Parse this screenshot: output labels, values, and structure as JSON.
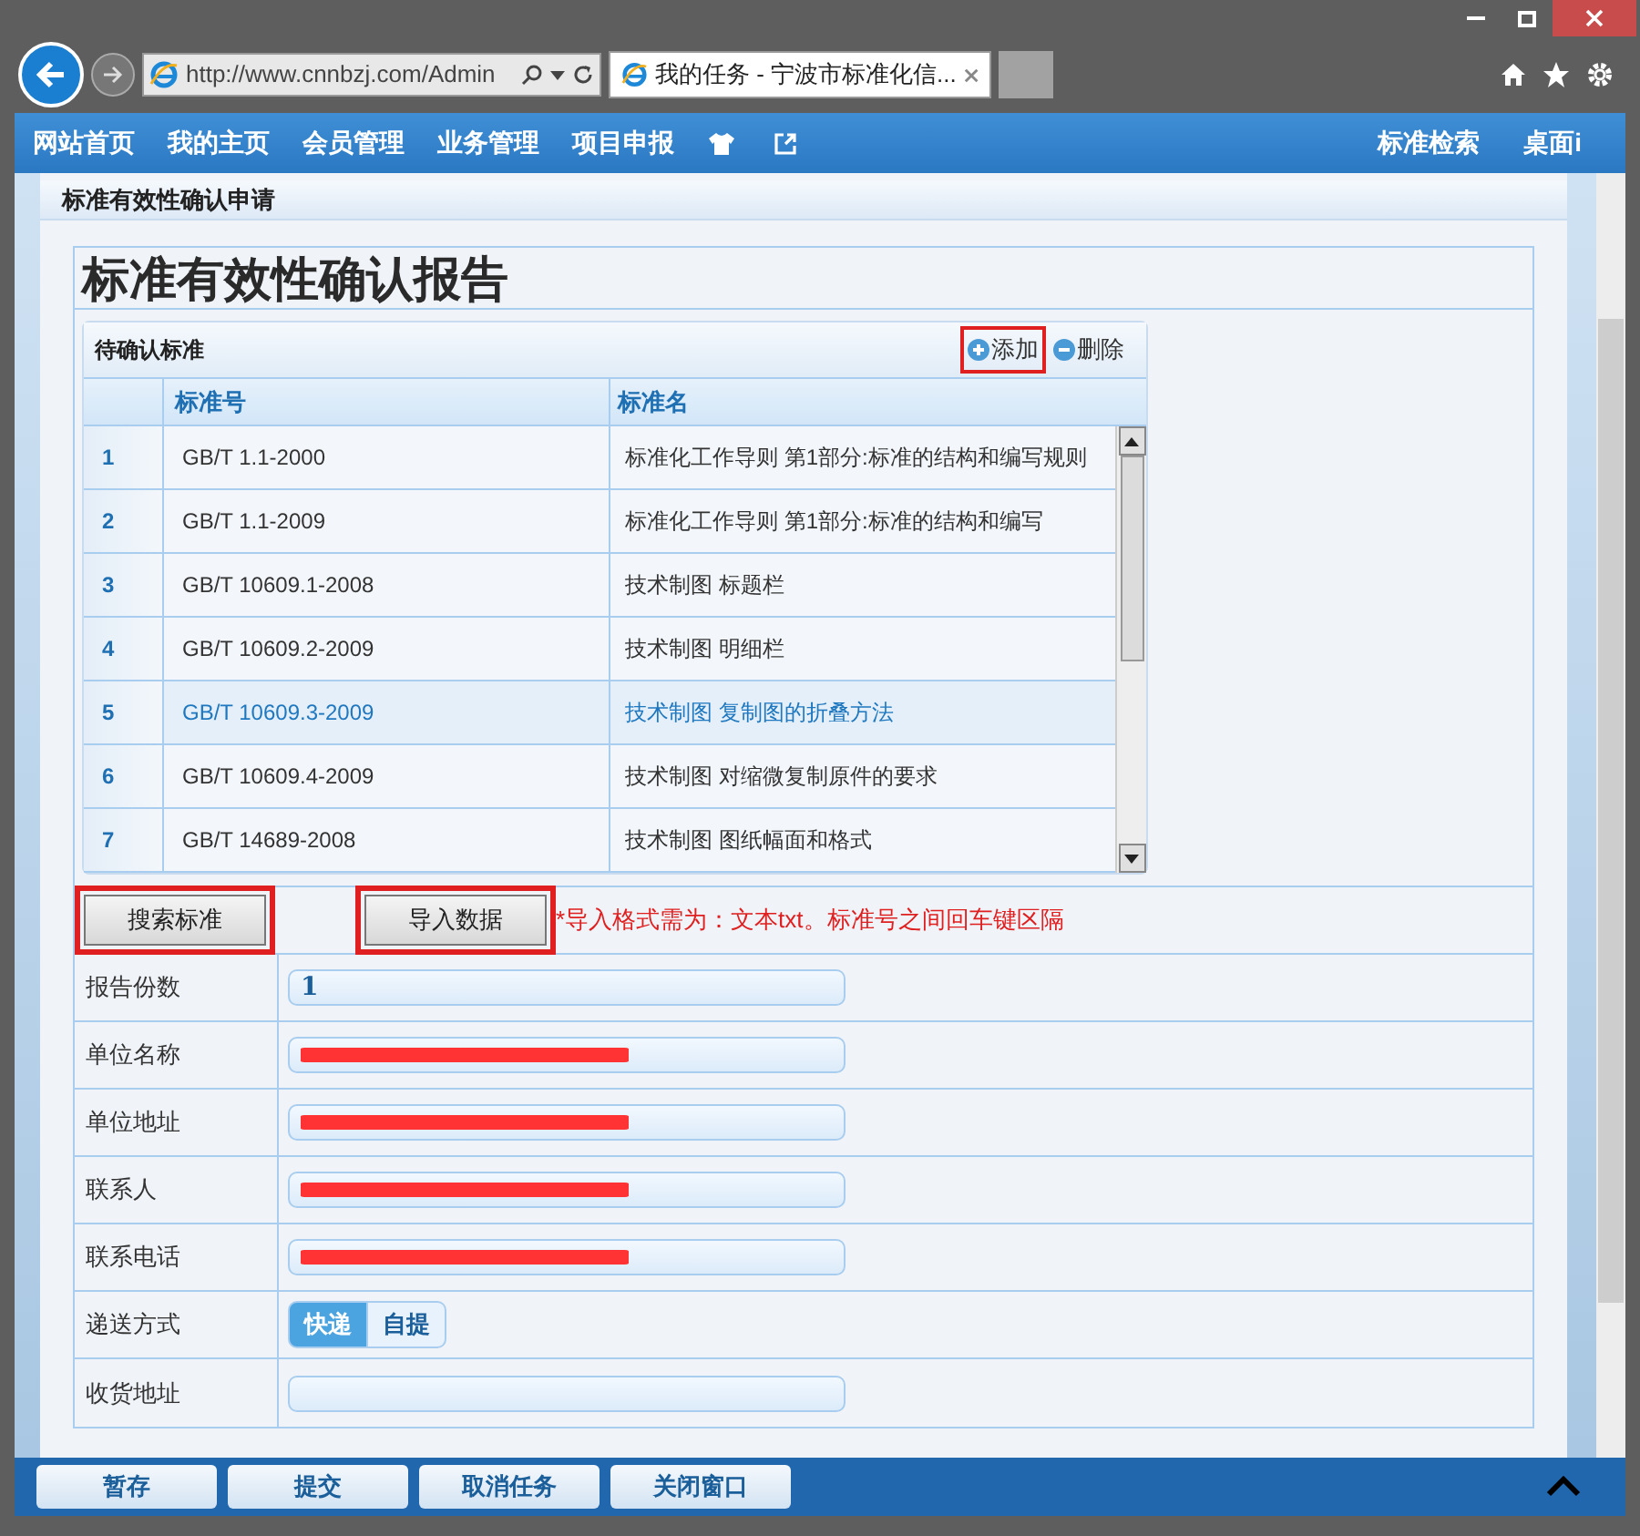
{
  "browser": {
    "address": "http://www.cnnbzj.com/Admin",
    "tabs": [
      {
        "title": "我的任务 - 宁波市标准化信...",
        "selected": true
      }
    ]
  },
  "nav": {
    "left": [
      "网站首页",
      "我的主页",
      "会员管理",
      "业务管理",
      "项目申报"
    ],
    "right": [
      "标准检索",
      "桌面i"
    ]
  },
  "section_title": "标准有效性确认申请",
  "report": {
    "title": "标准有效性确认报告",
    "grid": {
      "title": "待确认标准",
      "actions": [
        {
          "label": "添加",
          "kind": "add",
          "highlighted": true
        },
        {
          "label": "删除",
          "kind": "remove",
          "highlighted": false
        }
      ],
      "columns": [
        "标准号",
        "标准名"
      ],
      "rows": [
        {
          "index": "1",
          "code": "GB/T 1.1-2000",
          "name": "标准化工作导则 第1部分:标准的结构和编写规则",
          "selected": false
        },
        {
          "index": "2",
          "code": "GB/T 1.1-2009",
          "name": "标准化工作导则 第1部分:标准的结构和编写",
          "selected": false
        },
        {
          "index": "3",
          "code": "GB/T 10609.1-2008",
          "name": "技术制图 标题栏",
          "selected": false
        },
        {
          "index": "4",
          "code": "GB/T 10609.2-2009",
          "name": "技术制图 明细栏",
          "selected": false
        },
        {
          "index": "5",
          "code": "GB/T 10609.3-2009",
          "name": "技术制图 复制图的折叠方法",
          "selected": true
        },
        {
          "index": "6",
          "code": "GB/T 10609.4-2009",
          "name": "技术制图 对缩微复制原件的要求",
          "selected": false
        },
        {
          "index": "7",
          "code": "GB/T 14689-2008",
          "name": "技术制图 图纸幅面和格式",
          "selected": false
        }
      ]
    },
    "buttons": [
      {
        "label": "搜索标准",
        "highlighted": true
      },
      {
        "label": "导入数据",
        "highlighted": true
      }
    ],
    "import_note": "*导入格式需为：文本txt。标准号之间回车键区隔",
    "fields": [
      {
        "label": "报告份数",
        "kind": "text",
        "value": "1"
      },
      {
        "label": "单位名称",
        "kind": "redacted"
      },
      {
        "label": "单位地址",
        "kind": "redacted"
      },
      {
        "label": "联系人",
        "kind": "redacted"
      },
      {
        "label": "联系电话",
        "kind": "redacted"
      },
      {
        "label": "递送方式",
        "kind": "choice",
        "options": [
          {
            "label": "快递",
            "selected": true
          },
          {
            "label": "自提",
            "selected": false
          }
        ]
      },
      {
        "label": "收货地址",
        "kind": "text"
      }
    ]
  },
  "footer_buttons": [
    "暂存",
    "提交",
    "取消任务",
    "关闭窗口"
  ]
}
